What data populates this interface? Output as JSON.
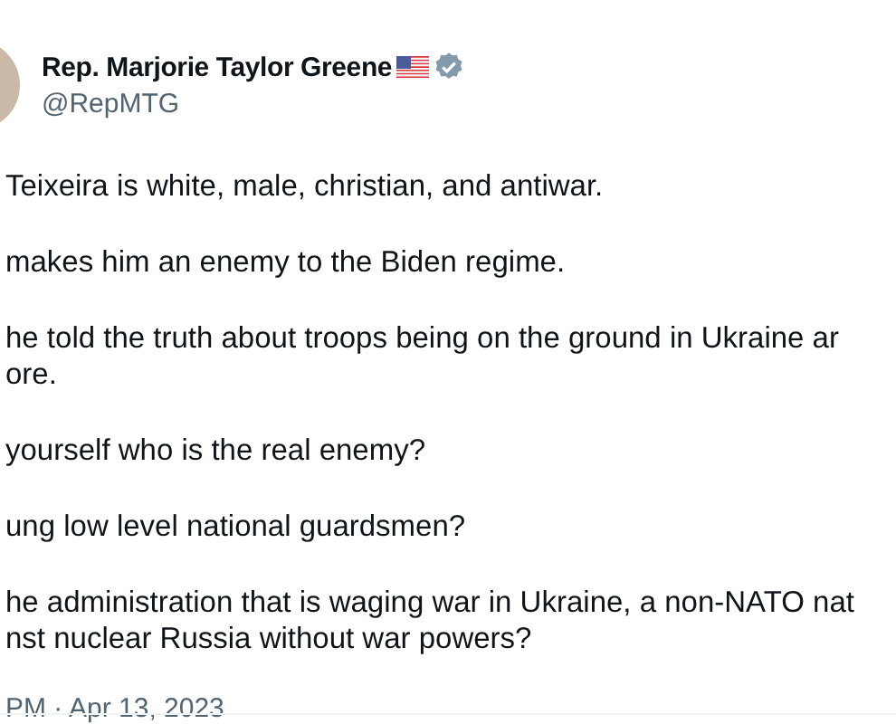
{
  "author": {
    "name": "Rep. Marjorie Taylor Greene",
    "handle": "@RepMTG",
    "verified": true
  },
  "paragraphs": [
    [
      "Teixeira is white, male, christian, and antiwar."
    ],
    [
      "makes him an enemy to the Biden regime."
    ],
    [
      "he told the truth about troops being on the ground in Ukraine ar",
      "ore."
    ],
    [
      "yourself who is the real enemy?"
    ],
    [
      "ung low level national guardsmen?"
    ],
    [
      "he administration that is waging war in Ukraine, a non-NATO nat",
      "nst nuclear Russia without war powers?"
    ]
  ],
  "timestamp": "PM · Apr 13, 2023"
}
